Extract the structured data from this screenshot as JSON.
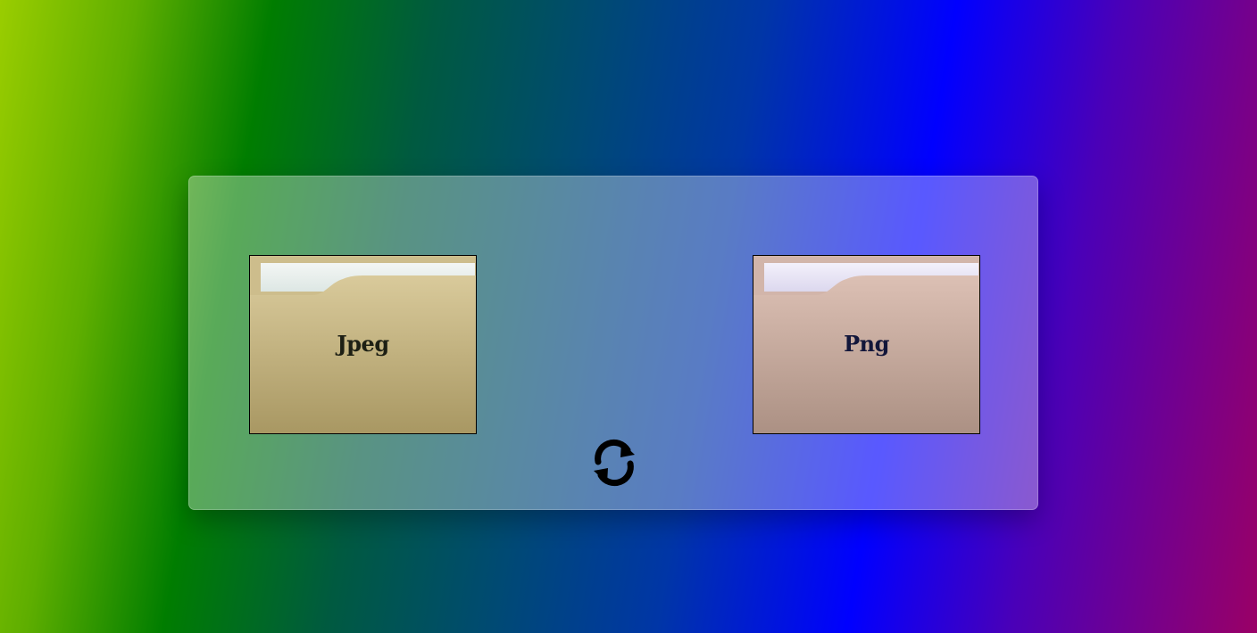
{
  "colors": {
    "page_gradient": [
      "#9acd00",
      "#007d00",
      "#004a73",
      "#0000ff",
      "#9a0066"
    ],
    "panel_overlay": "rgba(255,255,255,0.35)",
    "jpeg_folder": "#cdbd8c",
    "png_folder": "#d2b5aa",
    "refresh_icon": "#000000"
  },
  "folders": [
    {
      "label": "Jpeg",
      "icon": "folder-icon"
    },
    {
      "label": "Png",
      "icon": "folder-icon"
    }
  ],
  "actions": {
    "refresh_icon": "refresh-icon"
  }
}
